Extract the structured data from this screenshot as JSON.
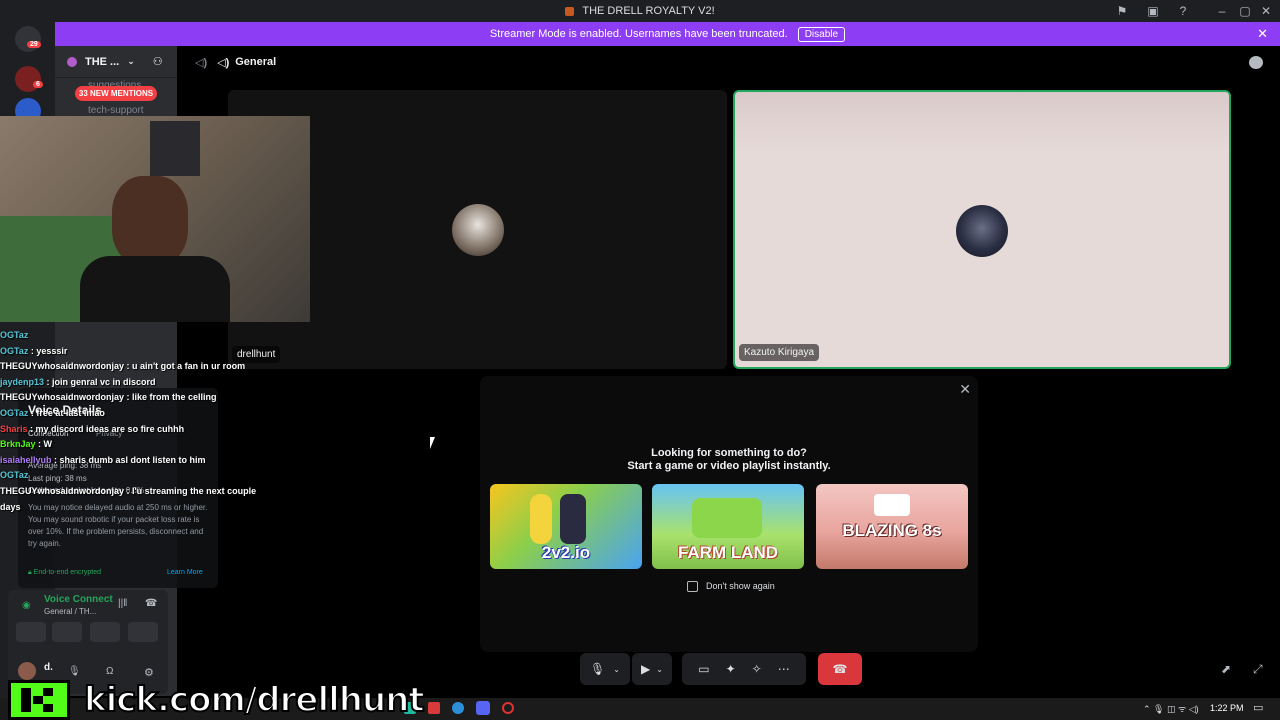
{
  "window": {
    "title": "THE DRELL ROYALTY V2!"
  },
  "banner": {
    "text": "Streamer Mode is enabled. Usernames have been truncated.",
    "disable_label": "Disable"
  },
  "server_rail": {
    "badges": [
      "29",
      "6"
    ]
  },
  "sidebar": {
    "server_name": "THE ...",
    "mentions": "33 NEW MENTIONS",
    "channels": [
      "suggestions",
      "tech-support"
    ]
  },
  "channel": {
    "name": "General"
  },
  "tiles": [
    {
      "name": "drellhunt"
    },
    {
      "name": "Kazuto Kirigaya"
    }
  ],
  "activity": {
    "line1": "Looking for something to do?",
    "line2": "Start a game or video playlist instantly.",
    "games": [
      "2v2.io",
      "FARM LAND",
      "BLAZING 8s"
    ],
    "dont_show": "Don't show again"
  },
  "chat": [
    {
      "user": "OGTaz",
      "msg": "",
      "color": "#56c4d6"
    },
    {
      "user": "OGTaz",
      "msg": "yesssir",
      "color": "#56c4d6"
    },
    {
      "user": "THEGUYwhosaidnwordonjay",
      "msg": "u ain't got a fan in ur room",
      "color": "#ffffff"
    },
    {
      "user": "jaydenp13",
      "msg": "join genral vc in discord",
      "color": "#56c4d6"
    },
    {
      "user": "THEGUYwhosaidnwordonjay",
      "msg": "like from the celling",
      "color": "#ffffff"
    },
    {
      "user": "OGTaz",
      "msg": "free at last lmao",
      "color": "#56c4d6"
    },
    {
      "user": "Sharis",
      "msg": "my discord ideas are so fire cuhhh",
      "color": "#f23f43"
    },
    {
      "user": "BrknJay",
      "msg": "W",
      "color": "#53fc18"
    },
    {
      "user": "isaiahellyub",
      "msg": "sharis dumb asl dont listen to him",
      "color": "#b07cf7"
    },
    {
      "user": "OGTaz",
      "msg": "",
      "color": "#56c4d6"
    },
    {
      "user": "THEGUYwhosaidnwordonjay",
      "msg": "I'u streaming the next couple",
      "color": "#ffffff"
    },
    {
      "user": "days",
      "msg": "",
      "color": "#ffffff"
    }
  ],
  "voice_details": {
    "title": "Voice Details",
    "tabs": [
      "Connection",
      "Privacy"
    ],
    "avg_ping": "Average ping: 38 ms",
    "last_ping": "Last ping: 38 ms",
    "packet_loss": "Outbound packet loss rate: 0.0%",
    "note": "You may notice delayed audio at 250 ms or higher. You may sound robotic if your packet loss rate is over 10%. If the problem persists, disconnect and try again.",
    "encrypted": "End-to-end encrypted",
    "learn_more": "Learn More"
  },
  "voice_connected": {
    "status": "Voice Connect",
    "sub": "General / TH..."
  },
  "user": {
    "name": "d."
  },
  "taskbar": {
    "clock": "1:22 PM"
  },
  "overlay": {
    "url": "kick.com/drellhunt"
  },
  "colors": {
    "banner": "#8d3ef5",
    "hangup": "#da373c",
    "kick_green": "#53fc18",
    "tile_highlight": "#23a55a"
  }
}
